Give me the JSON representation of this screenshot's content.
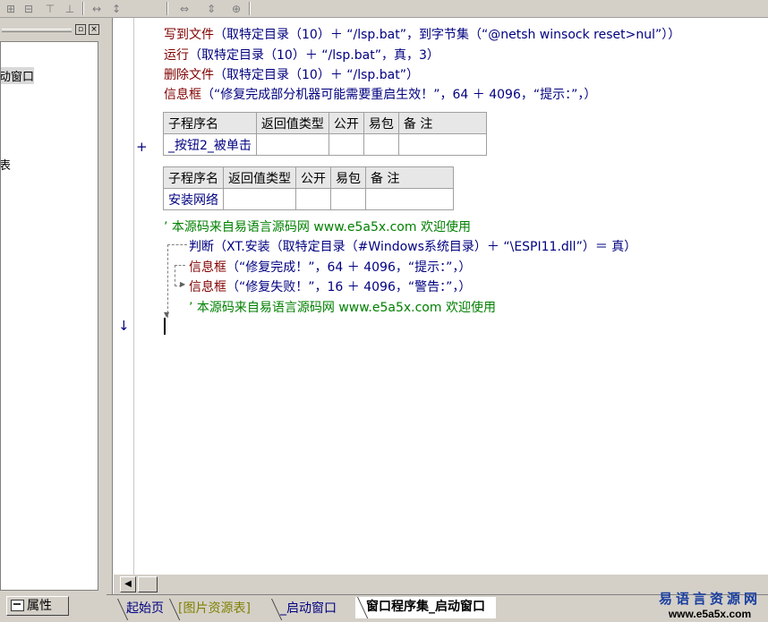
{
  "toolbar": {
    "icons": [
      "align-left-icon",
      "align-center-icon",
      "align-top-icon",
      "align-middle-icon",
      "space-horizontal-icon",
      "space-vertical-icon",
      "same-width-icon",
      "same-height-icon",
      "same-size-icon"
    ]
  },
  "left_panel": {
    "close_glyph": "×",
    "minimize_glyph": "▫",
    "tree_items": [
      "动窗口",
      "表"
    ],
    "properties_tab": "属性"
  },
  "code": {
    "line1": {
      "fn": "写到文件",
      "body": "（取特定目录（10）＋ “/lsp.bat”，到字节集（“@netsh winsock reset>nul”））"
    },
    "line2": {
      "fn": "运行",
      "body": "（取特定目录（10）＋ “/lsp.bat”，真，3）"
    },
    "line3": {
      "fn": "删除文件",
      "body": "（取特定目录（10）＋ “/lsp.bat”）"
    },
    "line4": {
      "fn": "信息框",
      "body": "（“修复完成部分机器可能需要重启生效！”，64 ＋ 4096，“提示：”，）"
    },
    "table1": {
      "headers": [
        "子程序名",
        "返回值类型",
        "公开",
        "易包",
        "备 注"
      ],
      "row": [
        "_按钮2_被单击",
        "",
        "",
        "",
        ""
      ]
    },
    "table2": {
      "headers": [
        "子程序名",
        "返回值类型",
        "公开",
        "易包",
        "备 注"
      ],
      "row": [
        "安装网络",
        "",
        "",
        "",
        ""
      ]
    },
    "comment1": "’ 本源码来自易语言源码网 www.e5a5x.com  欢迎使用",
    "if_line": {
      "kw": "判断",
      "body": "（XT.安装（取特定目录（#Windows系统目录）＋ “\\ESPI11.dll”）＝ 真）"
    },
    "then_line": {
      "fn": "信息框",
      "body": "（“修复完成！”，64 ＋ 4096，“提示：”，）"
    },
    "else_line": {
      "fn": "信息框",
      "body": "（“修复失败！”，16 ＋ 4096，“警告：”，）"
    },
    "comment2": "’ 本源码来自易语言源码网 www.e5a5x.com  欢迎使用",
    "gutter_plus": "+",
    "gutter_arrow": "↓"
  },
  "scrollbar": {
    "left_arrow": "◀"
  },
  "tabs": [
    {
      "label": "起始页",
      "active": false,
      "color": "#000080"
    },
    {
      "label": "[图片资源表]",
      "active": false,
      "color": "#808000"
    },
    {
      "label": "_启动窗口",
      "active": false,
      "color": "#000080"
    },
    {
      "label": "窗口程序集_启动窗口",
      "active": true,
      "color": "#000000"
    }
  ],
  "watermark": {
    "cn": "易语言资源网",
    "url": "www.e5a5x.com"
  }
}
